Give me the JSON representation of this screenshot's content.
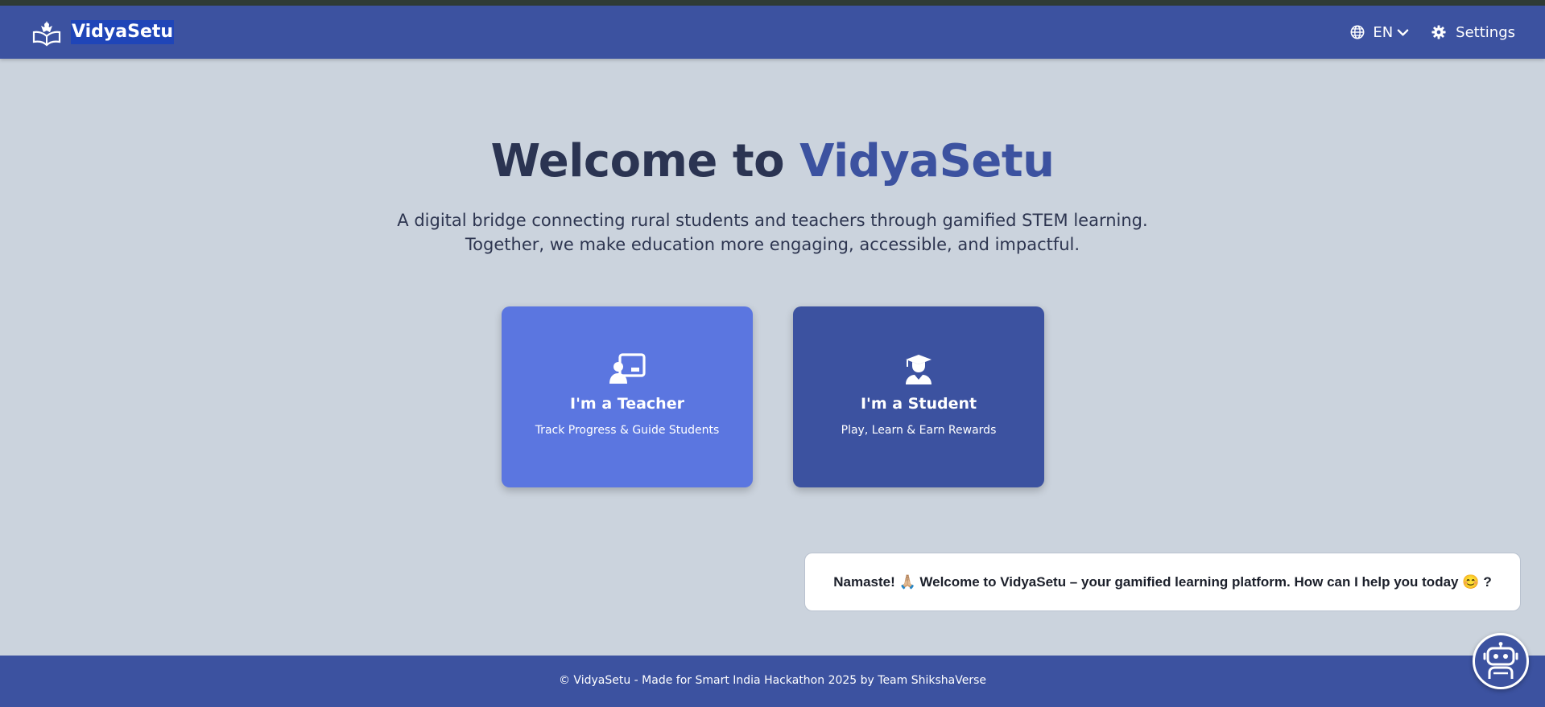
{
  "header": {
    "brand_name": "VidyaSetu",
    "language": "EN",
    "settings_label": "Settings",
    "logo_icon": "book-reader-icon"
  },
  "hero": {
    "title_prefix": "Welcome to ",
    "title_accent": "VidyaSetu",
    "subtitle_line1": "A digital bridge connecting rural students and teachers through gamified STEM learning.",
    "subtitle_line2": "Together, we make education more engaging, accessible, and impactful."
  },
  "roles": [
    {
      "title": "I'm a Teacher",
      "subtitle": "Track Progress & Guide Students",
      "icon": "chalkboard-teacher-icon",
      "color": "#5b76e0"
    },
    {
      "title": "I'm a Student",
      "subtitle": "Play, Learn & Earn Rewards",
      "icon": "user-graduate-icon",
      "color": "#3c52a0"
    }
  ],
  "chatbot": {
    "message_part1": "Namaste! ",
    "message_emoji1": "🙏🏼",
    "message_part2": " Welcome to VidyaSetu – your gamified learning platform. How can I help you today ",
    "message_emoji2": "😊",
    "message_part3": "?",
    "icon": "robot-icon"
  },
  "footer": {
    "text": "© VidyaSetu - Made for Smart India Hackathon 2025 by Team ShikshaVerse"
  },
  "colors": {
    "primary": "#3c52a0",
    "teacher_card": "#5b76e0",
    "background": "#cbd3dd",
    "heading": "#2b3452"
  }
}
